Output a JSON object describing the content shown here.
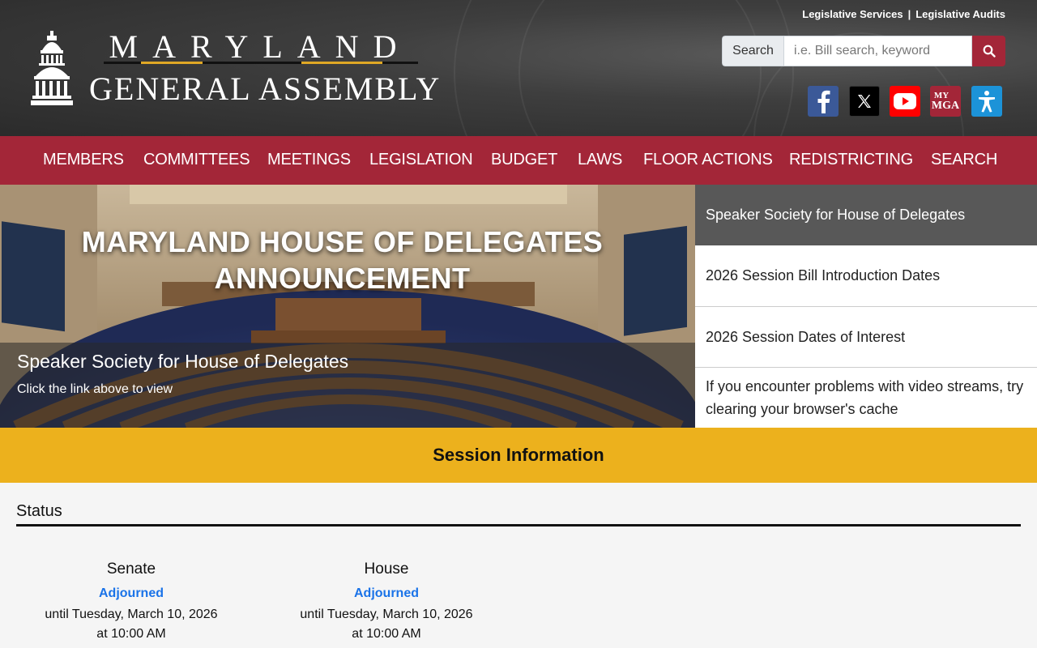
{
  "header": {
    "top_links": [
      "Legislative Services",
      "Legislative Audits"
    ],
    "logo_line1": "MARYLAND",
    "logo_line2": "GENERAL ASSEMBLY",
    "search_label": "Search",
    "search_placeholder": "i.e. Bill search, keyword",
    "social": {
      "facebook": "facebook-icon",
      "x": "x-icon",
      "youtube": "youtube-icon",
      "mymga_line1": "MY",
      "mymga_line2": "MGA",
      "accessibility": "accessibility-icon"
    }
  },
  "nav": {
    "items": [
      "MEMBERS",
      "COMMITTEES",
      "MEETINGS",
      "LEGISLATION",
      "BUDGET",
      "LAWS",
      "FLOOR ACTIONS",
      "REDISTRICTING",
      "SEARCH"
    ]
  },
  "hero": {
    "title_line1": "MARYLAND HOUSE OF DELEGATES",
    "title_line2": "ANNOUNCEMENT",
    "caption_title": "Speaker Society for House of Delegates",
    "caption_sub": "Click the link above to view",
    "list": [
      "Speaker Society for House of Delegates",
      "2026 Session Bill Introduction Dates",
      "2026 Session Dates of Interest",
      "If you encounter problems with video streams, try clearing your browser's cache"
    ]
  },
  "session": {
    "heading": "Session Information",
    "status_title": "Status",
    "senate": {
      "name": "Senate",
      "state": "Adjourned",
      "until_line1": "until Tuesday, March 10, 2026",
      "until_line2": "at 10:00 AM"
    },
    "house": {
      "name": "House",
      "state": "Adjourned",
      "until_line1": "until Tuesday, March 10, 2026",
      "until_line2": "at 10:00 AM"
    }
  },
  "colors": {
    "brand_red": "#a32638",
    "gold": "#ecb11d",
    "link_blue": "#1a73e8"
  }
}
